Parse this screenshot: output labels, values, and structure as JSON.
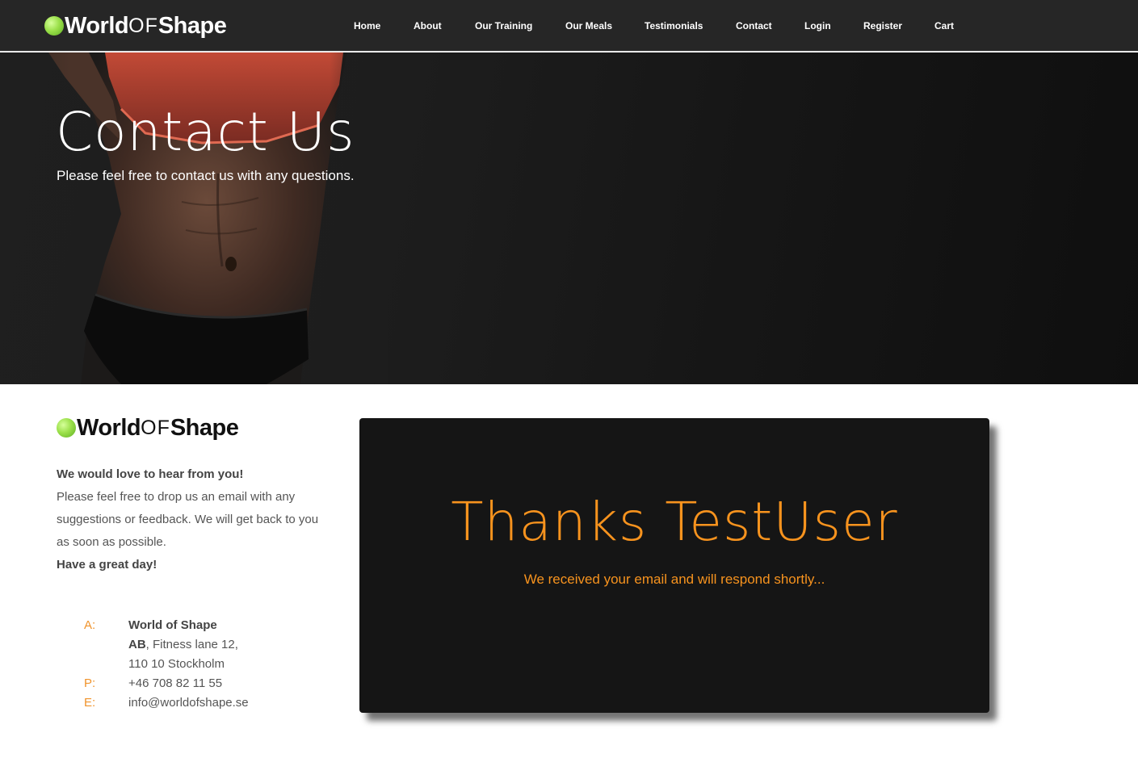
{
  "brand": {
    "part1": "World",
    "part2": "OF",
    "part3": "Shape",
    "accent": "#8fd83f"
  },
  "nav": {
    "items": [
      {
        "label": "Home"
      },
      {
        "label": "About"
      },
      {
        "label": "Our Training"
      },
      {
        "label": "Our Meals"
      },
      {
        "label": "Testimonials"
      },
      {
        "label": "Contact"
      },
      {
        "label": "Login"
      },
      {
        "label": "Register"
      },
      {
        "label": "Cart"
      }
    ]
  },
  "hero": {
    "title": "Contact Us",
    "subtitle": "Please feel free to contact us with any questions."
  },
  "intro": {
    "heading": "We would love to hear from you!",
    "body_lines": [
      "Please feel free to drop us an email with any",
      "suggestions or feedback. We will get back to you",
      "as soon as possible."
    ],
    "closing": "Have a great day!"
  },
  "address": {
    "a_label": "A:",
    "company": "World of Shape",
    "company_suffix_bold": "AB",
    "street": ", Fitness lane 12,",
    "city": "110 10 Stockholm",
    "p_label": "P:",
    "phone": "+46 708 82 11 55",
    "e_label": "E:",
    "email": "info@worldofshape.se"
  },
  "confirmation": {
    "title": "Thanks TestUser",
    "message": "We received your email and will respond shortly...",
    "accent": "#f7931e"
  }
}
